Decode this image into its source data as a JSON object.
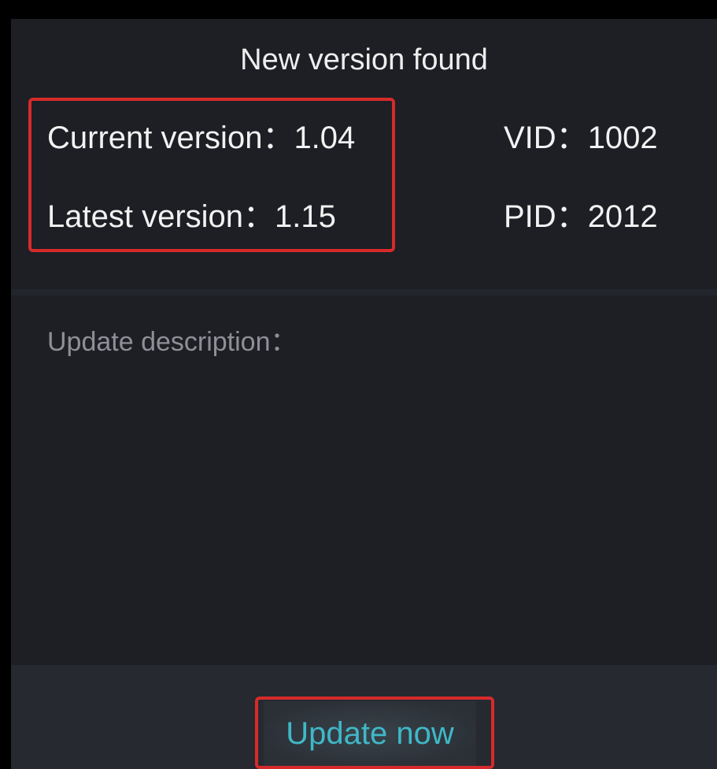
{
  "dialog": {
    "title": "New version found"
  },
  "versions": {
    "current_label": "Current version：",
    "current_value": "1.04",
    "latest_label": "Latest version：",
    "latest_value": "1.15"
  },
  "device": {
    "vid_label": "VID：",
    "vid_value": "1002",
    "pid_label": "PID：",
    "pid_value": "2012"
  },
  "description": {
    "label": "Update description："
  },
  "footer": {
    "update_button_label": "Update now"
  },
  "colors": {
    "background": "#1d1f25",
    "footer": "#262930",
    "highlight": "#d62a2a",
    "button_text": "#3fb8c8"
  }
}
